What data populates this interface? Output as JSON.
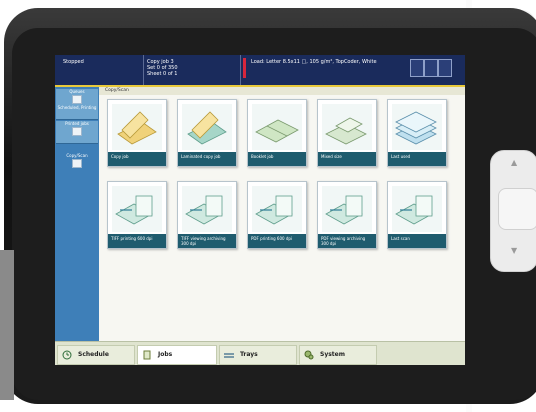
{
  "status_bar": {
    "state": "Stopped",
    "job_title": "Copy job 3",
    "job_line2": "Set 0 of 350",
    "job_line3": "Sheet 0 of 1",
    "load_label": "Load:",
    "load_value": "Letter 8.5x11 □, 105 g/m², TopCoder, White"
  },
  "breadcrumb": "Copy/Scan",
  "sidebar": {
    "items": [
      {
        "label": "Queues",
        "sub": "Scheduled, Printing"
      },
      {
        "label": "Printed jobs",
        "sub": ""
      },
      {
        "label": "Copy/Scan",
        "sub": ""
      }
    ]
  },
  "tiles": [
    {
      "label": "Copy job",
      "icon": "copy-icon"
    },
    {
      "label": "Laminated copy job",
      "icon": "laminated-copy-icon"
    },
    {
      "label": "Booklet job",
      "icon": "booklet-icon"
    },
    {
      "label": "Mixed size",
      "icon": "mixed-size-icon"
    },
    {
      "label": "Last used",
      "icon": "last-used-icon"
    },
    {
      "label": "TIFF printing 600 dpi",
      "icon": "scan-to-file-icon"
    },
    {
      "label": "TIFF viewing archiving 300 dpi",
      "icon": "scan-to-file-icon"
    },
    {
      "label": "PDF printing 600 dpi",
      "icon": "scan-to-file-icon"
    },
    {
      "label": "PDF viewing archiving 300 dpi",
      "icon": "scan-to-file-icon"
    },
    {
      "label": "Last scan",
      "icon": "scan-to-file-icon"
    }
  ],
  "bottom_tabs": [
    {
      "label": "Schedule",
      "icon": "clock-icon"
    },
    {
      "label": "Jobs",
      "icon": "jobs-icon"
    },
    {
      "label": "Trays",
      "icon": "trays-icon"
    },
    {
      "label": "System",
      "icon": "gears-icon"
    }
  ],
  "colors": {
    "status_bar": "#1a2b5c",
    "sidebar": "#3e7fb8",
    "tile_caption": "#1f5c6e",
    "accent_yellow": "#e9c93a",
    "accent_red": "#d7263d"
  }
}
